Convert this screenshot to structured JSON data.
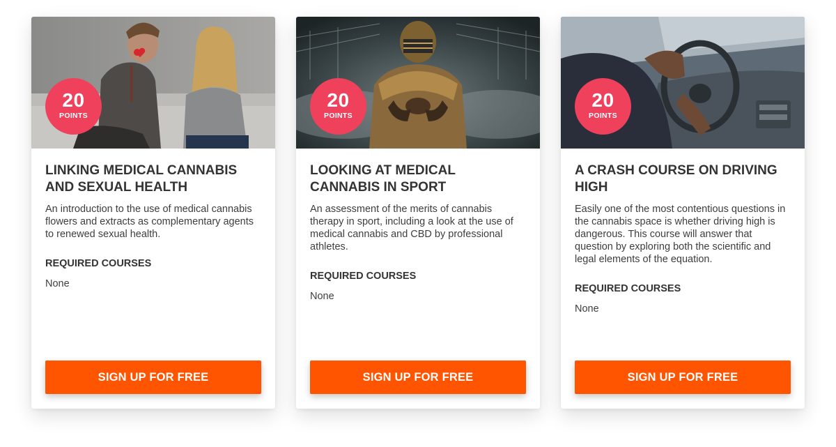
{
  "courses": [
    {
      "image_alt": "couple on sofa, man holding heart",
      "points_value": "20",
      "points_label": "POINTS",
      "title": "LINKING MEDICAL CANNABIS AND SEXUAL HEALTH",
      "description": "An introduction to the use of medical cannabis flowers and extracts as complementary agents to renewed sexual health.",
      "required_heading": "REQUIRED COURSES",
      "required_value": "None",
      "cta_label": "SIGN UP FOR FREE"
    },
    {
      "image_alt": "football player in stadium smoke",
      "points_value": "20",
      "points_label": "POINTS",
      "title": "LOOKING AT MEDICAL CANNABIS IN SPORT",
      "description": "An assessment of the merits of cannabis therapy in sport, including a look at the use of medical cannabis and CBD by professional athletes.",
      "required_heading": "REQUIRED COURSES",
      "required_value": "None",
      "cta_label": "SIGN UP FOR FREE"
    },
    {
      "image_alt": "person smoking while driving a car",
      "points_value": "20",
      "points_label": "POINTS",
      "title": "A CRASH COURSE ON DRIVING HIGH",
      "description": "Easily one of the most contentious questions in the cannabis space is whether driving high is dangerous. This course will answer that question by exploring both the scientific and legal elements of the equation.",
      "required_heading": "REQUIRED COURSES",
      "required_value": "None",
      "cta_label": "SIGN UP FOR FREE"
    }
  ],
  "colors": {
    "badge": "#f0415c",
    "cta": "#ff5400",
    "heading_text": "#333333",
    "body_text": "#3d3d3d"
  }
}
